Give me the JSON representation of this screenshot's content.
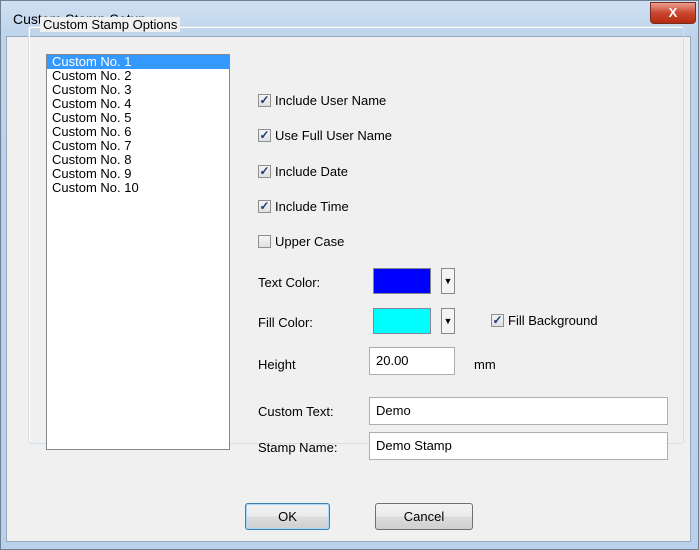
{
  "window": {
    "title": "Custom Stamp Setup",
    "close_glyph": "X"
  },
  "group": {
    "label": "Custom Stamp Options"
  },
  "list": {
    "items": [
      "Custom No. 1",
      "Custom No. 2",
      "Custom No. 3",
      "Custom No. 4",
      "Custom No. 5",
      "Custom No. 6",
      "Custom No. 7",
      "Custom No. 8",
      "Custom No. 9",
      "Custom No. 10"
    ],
    "selected_index": 0
  },
  "options": {
    "include_user_name": {
      "label": "Include User Name",
      "checked": true
    },
    "use_full_user_name": {
      "label": "Use Full User Name",
      "checked": true
    },
    "include_date": {
      "label": "Include Date",
      "checked": true
    },
    "include_time": {
      "label": "Include Time",
      "checked": true
    },
    "upper_case": {
      "label": "Upper Case",
      "checked": false
    }
  },
  "text_color": {
    "label": "Text Color:",
    "value": "#0000ff"
  },
  "fill_color": {
    "label": "Fill Color:",
    "value": "#00ffff"
  },
  "fill_background": {
    "label": "Fill Background",
    "checked": true
  },
  "height": {
    "label": "Height",
    "value": "20.00",
    "unit": "mm"
  },
  "custom_text": {
    "label": "Custom Text:",
    "value": "Demo"
  },
  "stamp_name": {
    "label": "Stamp Name:",
    "value": "Demo Stamp"
  },
  "buttons": {
    "ok": "OK",
    "cancel": "Cancel"
  }
}
